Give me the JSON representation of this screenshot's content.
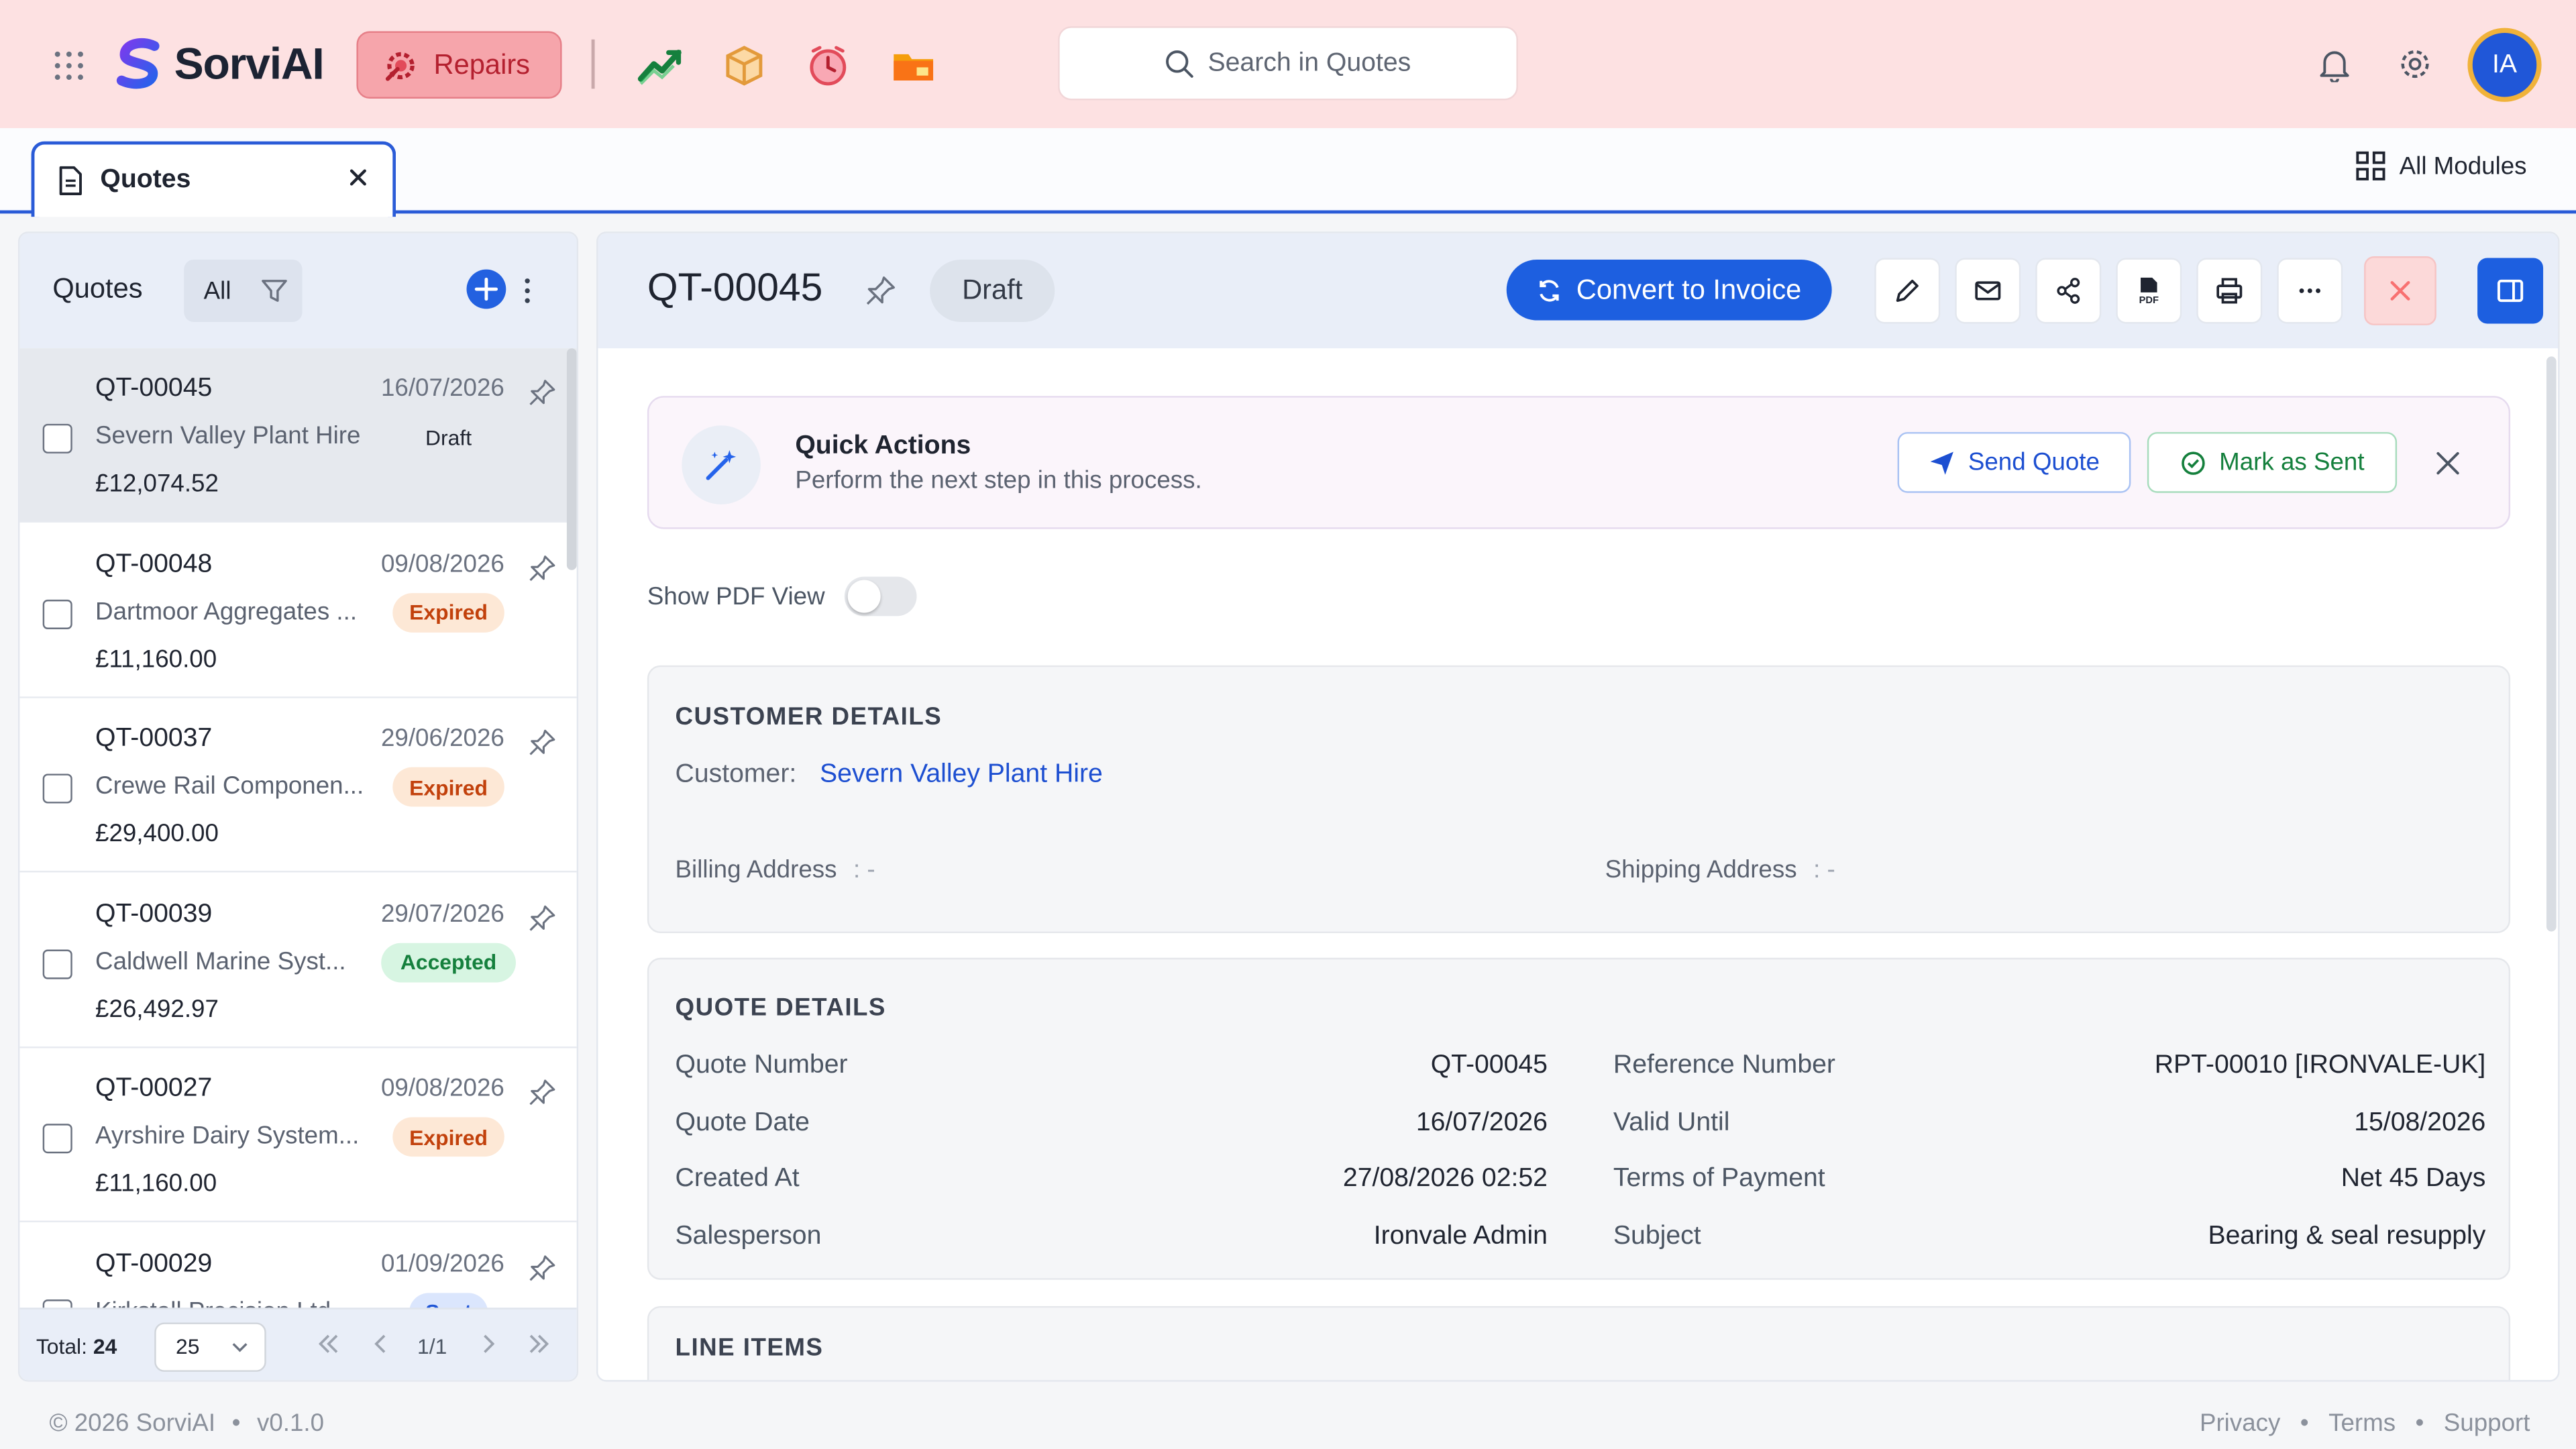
{
  "brand": {
    "name": "SorviAI"
  },
  "topbar": {
    "active_module": "Repairs",
    "search_placeholder": "Search in Quotes",
    "avatar_initials": "IA",
    "modules": [
      "trend-chart-icon",
      "package-icon",
      "alarm-clock-icon",
      "folder-icon"
    ]
  },
  "tabs": {
    "active_tab": "Quotes",
    "all_modules_label": "All Modules"
  },
  "list": {
    "title": "Quotes",
    "filter_label": "All",
    "items": [
      {
        "id": "QT-00045",
        "date": "16/07/2026",
        "customer": "Severn Valley Plant Hire",
        "status": "Draft",
        "amount": "£12,074.52"
      },
      {
        "id": "QT-00048",
        "date": "09/08/2026",
        "customer": "Dartmoor Aggregates ...",
        "status": "Expired",
        "amount": "£11,160.00"
      },
      {
        "id": "QT-00037",
        "date": "29/06/2026",
        "customer": "Crewe Rail Componen...",
        "status": "Expired",
        "amount": "£29,400.00"
      },
      {
        "id": "QT-00039",
        "date": "29/07/2026",
        "customer": "Caldwell Marine Syst...",
        "status": "Accepted",
        "amount": "£26,492.97"
      },
      {
        "id": "QT-00027",
        "date": "09/08/2026",
        "customer": "Ayrshire Dairy System...",
        "status": "Expired",
        "amount": "£11,160.00"
      },
      {
        "id": "QT-00029",
        "date": "01/09/2026",
        "customer": "Kirkstall Precision Ltd",
        "status": "Sent",
        "amount": ""
      }
    ],
    "footer": {
      "total_label": "Total:",
      "total_value": "24",
      "page_size": "25",
      "page": "1/1"
    }
  },
  "detail": {
    "id": "QT-00045",
    "status": "Draft",
    "convert_label": "Convert to Invoice",
    "quick_actions": {
      "title": "Quick Actions",
      "subtitle": "Perform the next step in this process.",
      "send_label": "Send Quote",
      "mark_label": "Mark as Sent"
    },
    "pdf_toggle_label": "Show PDF View",
    "customer_details": {
      "heading": "CUSTOMER DETAILS",
      "customer_label": "Customer:",
      "customer_value": "Severn Valley Plant Hire",
      "billing_label": "Billing Address",
      "billing_value": ": -",
      "shipping_label": "Shipping Address",
      "shipping_value": ": -"
    },
    "quote_details": {
      "heading": "QUOTE DETAILS",
      "left": [
        {
          "label": "Quote Number",
          "value": "QT-00045"
        },
        {
          "label": "Quote Date",
          "value": "16/07/2026"
        },
        {
          "label": "Created At",
          "value": "27/08/2026 02:52"
        },
        {
          "label": "Salesperson",
          "value": "Ironvale Admin"
        }
      ],
      "right": [
        {
          "label": "Reference Number",
          "value": "RPT-00010 [IRONVALE-UK]"
        },
        {
          "label": "Valid Until",
          "value": "15/08/2026"
        },
        {
          "label": "Terms of Payment",
          "value": "Net 45 Days"
        },
        {
          "label": "Subject",
          "value": "Bearing & seal resupply"
        }
      ]
    },
    "line_items_heading": "LINE ITEMS"
  },
  "footer": {
    "copyright": "© 2026 SorviAI",
    "version": "v0.1.0",
    "links": [
      "Privacy",
      "Terms",
      "Support"
    ]
  },
  "colors": {
    "accent": "#1d5fe0",
    "topbar_bg": "#fde1e2",
    "repairs_bg": "#f6a5ab"
  }
}
